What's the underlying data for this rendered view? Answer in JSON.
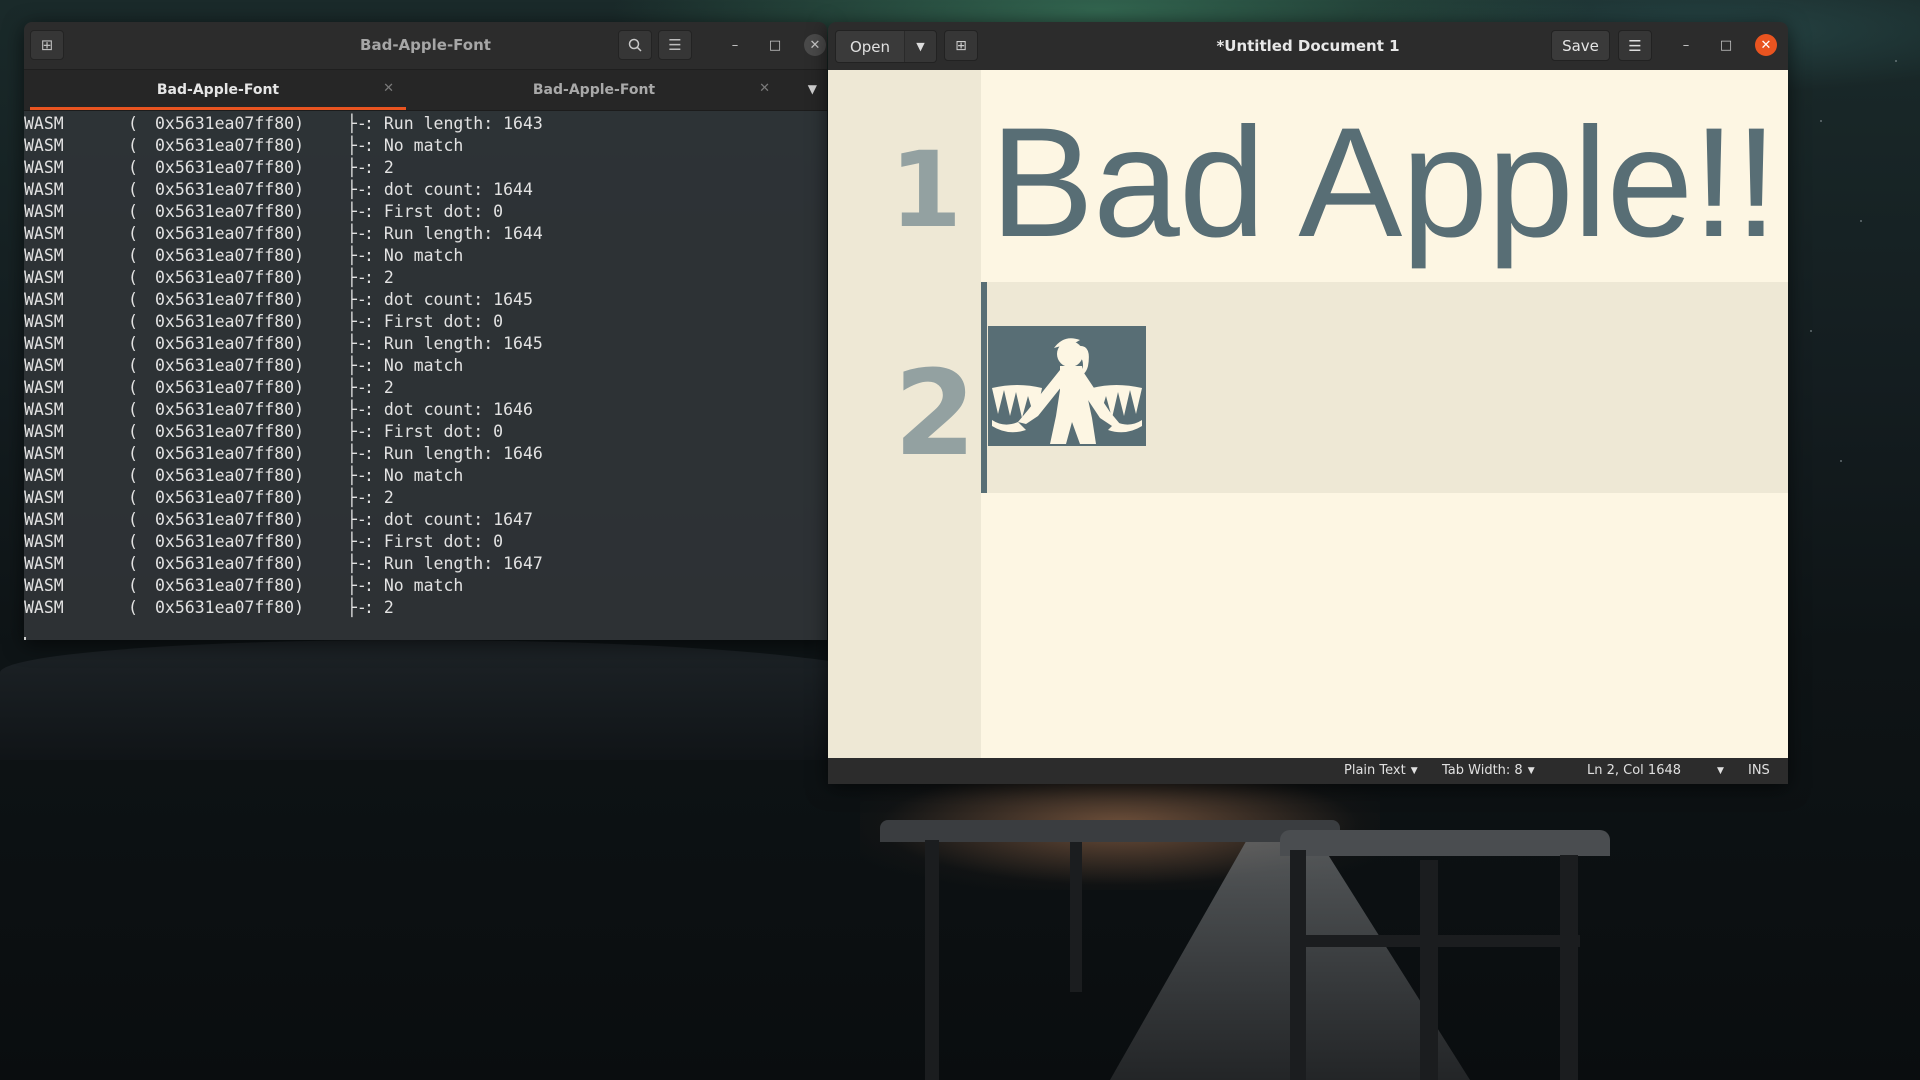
{
  "terminal": {
    "title": "Bad-Apple-Font",
    "tabs": [
      {
        "label": "Bad-Apple-Font",
        "active": true
      },
      {
        "label": "Bad-Apple-Font",
        "active": false
      }
    ],
    "search_icon": "search-icon",
    "menu_icon": "hamburger-menu-icon",
    "lines": [
      {
        "src": "WASM",
        "paren": "(",
        "addr": "0x5631ea07ff80)",
        "tree": "├-",
        "msg": ": Run length: 1643"
      },
      {
        "src": "WASM",
        "paren": "(",
        "addr": "0x5631ea07ff80)",
        "tree": "├-",
        "msg": ": No match"
      },
      {
        "src": "WASM",
        "paren": "(",
        "addr": "0x5631ea07ff80)",
        "tree": "├-",
        "msg": ": 2"
      },
      {
        "src": "WASM",
        "paren": "(",
        "addr": "0x5631ea07ff80)",
        "tree": "├-",
        "msg": ": dot count: 1644"
      },
      {
        "src": "WASM",
        "paren": "(",
        "addr": "0x5631ea07ff80)",
        "tree": "├-",
        "msg": ": First dot: 0"
      },
      {
        "src": "WASM",
        "paren": "(",
        "addr": "0x5631ea07ff80)",
        "tree": "├-",
        "msg": ": Run length: 1644"
      },
      {
        "src": "WASM",
        "paren": "(",
        "addr": "0x5631ea07ff80)",
        "tree": "├-",
        "msg": ": No match"
      },
      {
        "src": "WASM",
        "paren": "(",
        "addr": "0x5631ea07ff80)",
        "tree": "├-",
        "msg": ": 2"
      },
      {
        "src": "WASM",
        "paren": "(",
        "addr": "0x5631ea07ff80)",
        "tree": "├-",
        "msg": ": dot count: 1645"
      },
      {
        "src": "WASM",
        "paren": "(",
        "addr": "0x5631ea07ff80)",
        "tree": "├-",
        "msg": ": First dot: 0"
      },
      {
        "src": "WASM",
        "paren": "(",
        "addr": "0x5631ea07ff80)",
        "tree": "├-",
        "msg": ": Run length: 1645"
      },
      {
        "src": "WASM",
        "paren": "(",
        "addr": "0x5631ea07ff80)",
        "tree": "├-",
        "msg": ": No match"
      },
      {
        "src": "WASM",
        "paren": "(",
        "addr": "0x5631ea07ff80)",
        "tree": "├-",
        "msg": ": 2"
      },
      {
        "src": "WASM",
        "paren": "(",
        "addr": "0x5631ea07ff80)",
        "tree": "├-",
        "msg": ": dot count: 1646"
      },
      {
        "src": "WASM",
        "paren": "(",
        "addr": "0x5631ea07ff80)",
        "tree": "├-",
        "msg": ": First dot: 0"
      },
      {
        "src": "WASM",
        "paren": "(",
        "addr": "0x5631ea07ff80)",
        "tree": "├-",
        "msg": ": Run length: 1646"
      },
      {
        "src": "WASM",
        "paren": "(",
        "addr": "0x5631ea07ff80)",
        "tree": "├-",
        "msg": ": No match"
      },
      {
        "src": "WASM",
        "paren": "(",
        "addr": "0x5631ea07ff80)",
        "tree": "├-",
        "msg": ": 2"
      },
      {
        "src": "WASM",
        "paren": "(",
        "addr": "0x5631ea07ff80)",
        "tree": "├-",
        "msg": ": dot count: 1647"
      },
      {
        "src": "WASM",
        "paren": "(",
        "addr": "0x5631ea07ff80)",
        "tree": "├-",
        "msg": ": First dot: 0"
      },
      {
        "src": "WASM",
        "paren": "(",
        "addr": "0x5631ea07ff80)",
        "tree": "├-",
        "msg": ": Run length: 1647"
      },
      {
        "src": "WASM",
        "paren": "(",
        "addr": "0x5631ea07ff80)",
        "tree": "├-",
        "msg": ": No match"
      },
      {
        "src": "WASM",
        "paren": "(",
        "addr": "0x5631ea07ff80)",
        "tree": "├-",
        "msg": ": 2"
      }
    ]
  },
  "gedit": {
    "open_label": "Open",
    "title": "*Untitled Document 1",
    "save_label": "Save",
    "editor": {
      "line_numbers": [
        "1",
        "2"
      ],
      "line1_text": "Bad Apple!!"
    },
    "status": {
      "language": "Plain Text",
      "tab_width": "Tab Width: 8",
      "position": "Ln 2, Col 1648",
      "mode": "INS"
    }
  },
  "colors": {
    "accent": "#e95420",
    "editor_bg": "#fdf6e3",
    "editor_text": "#586e75"
  }
}
